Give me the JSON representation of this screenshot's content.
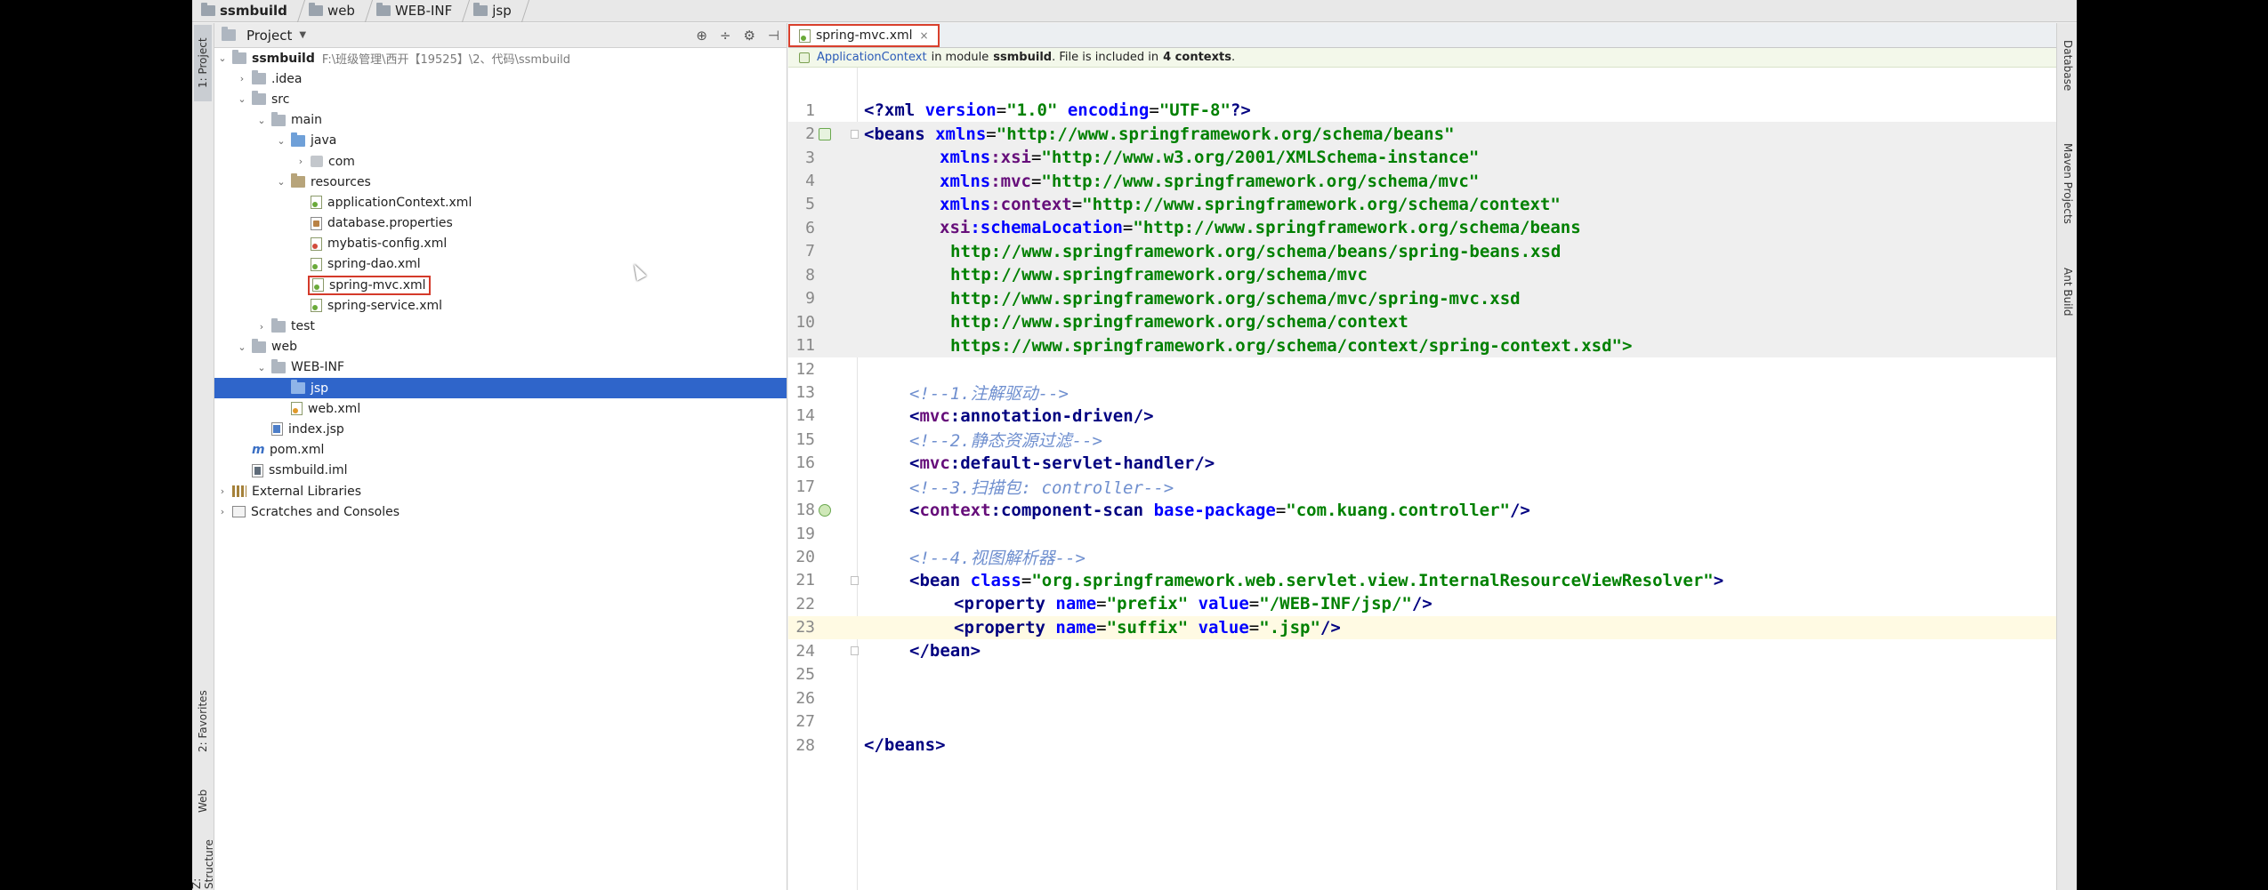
{
  "breadcrumb": [
    "ssmbuild",
    "web",
    "WEB-INF",
    "jsp"
  ],
  "left_strip": {
    "project_tab": "1: Project",
    "favorites_tab": "2: Favorites",
    "web_tab": "Web",
    "structure_tab": "Z: Structure"
  },
  "right_strip": {
    "database_tab": "Database",
    "maven_tab": "Maven Projects",
    "ant_tab": "Ant Build"
  },
  "project_panel": {
    "title": "Project",
    "root_name": "ssmbuild",
    "root_path": "F:\\班级管理\\西开【19525】\\2、代码\\ssmbuild",
    "items": {
      "idea": ".idea",
      "src": "src",
      "main": "main",
      "java": "java",
      "com": "com",
      "resources": "resources",
      "app_ctx": "applicationContext.xml",
      "db_props": "database.properties",
      "mybatis": "mybatis-config.xml",
      "spring_dao": "spring-dao.xml",
      "spring_mvc": "spring-mvc.xml",
      "spring_service": "spring-service.xml",
      "test": "test",
      "web": "web",
      "webinf": "WEB-INF",
      "jsp": "jsp",
      "webxml": "web.xml",
      "index": "index.jsp",
      "pom": "pom.xml",
      "iml": "ssmbuild.iml",
      "ext_libs": "External Libraries",
      "scratches": "Scratches and Consoles"
    }
  },
  "editor": {
    "tab_label": "spring-mvc.xml",
    "info": {
      "link": "ApplicationContext",
      "mid": "in module",
      "module": "ssmbuild",
      "tail": ". File is included in",
      "contexts": "4 contexts",
      "end": "."
    },
    "line_numbers": [
      "1",
      "2",
      "3",
      "4",
      "5",
      "6",
      "7",
      "8",
      "9",
      "10",
      "11",
      "12",
      "13",
      "14",
      "15",
      "16",
      "17",
      "18",
      "19",
      "20",
      "21",
      "22",
      "23",
      "24",
      "25",
      "26",
      "27",
      "28"
    ],
    "code": {
      "l1": [
        "<?",
        "xml ",
        "version",
        "=",
        "\"1.0\"",
        " ",
        "encoding",
        "=",
        "\"UTF-8\"",
        "?>"
      ],
      "l2": [
        "<",
        "beans ",
        "xmlns",
        "=",
        "\"http://www.springframework.org/schema/beans\""
      ],
      "l3": [
        "xmlns",
        ":xsi",
        "=",
        "\"http://www.w3.org/2001/XMLSchema-instance\""
      ],
      "l4": [
        "xmlns",
        ":mvc",
        "=",
        "\"http://www.springframework.org/schema/mvc\""
      ],
      "l5": [
        "xmlns",
        ":context",
        "=",
        "\"http://www.springframework.org/schema/context\""
      ],
      "l6": [
        "xsi",
        ":schemaLocation",
        "=",
        "\"http://www.springframework.org/schema/beans"
      ],
      "l7": "http://www.springframework.org/schema/beans/spring-beans.xsd",
      "l8": "http://www.springframework.org/schema/mvc",
      "l9": "http://www.springframework.org/schema/mvc/spring-mvc.xsd",
      "l10": "http://www.springframework.org/schema/context",
      "l11": "https://www.springframework.org/schema/context/spring-context.xsd\">",
      "l13": "<!--1.注解驱动-->",
      "l14": [
        "<",
        "mvc",
        ":annotation-driven",
        "/>"
      ],
      "l15": "<!--2.静态资源过滤-->",
      "l16": [
        "<",
        "mvc",
        ":default-servlet-handler",
        "/>"
      ],
      "l17": "<!--3.扫描包: controller-->",
      "l18": [
        "<",
        "context",
        ":component-scan ",
        "base-package",
        "=",
        "\"com.kuang.controller\"",
        "/>"
      ],
      "l20": "<!--4.视图解析器-->",
      "l21": [
        "<",
        "bean ",
        "class",
        "=",
        "\"org.springframework.web.servlet.view.InternalResourceViewResolver\"",
        ">"
      ],
      "l22": [
        "<",
        "property ",
        "name",
        "=",
        "\"prefix\"",
        " ",
        "value",
        "=",
        "\"/WEB-INF/jsp/\"",
        "/>"
      ],
      "l23": [
        "<",
        "property ",
        "name",
        "=",
        "\"suffix\"",
        " ",
        "value",
        "=",
        "\".jsp\"",
        "/>"
      ],
      "l24": [
        "</",
        "bean",
        ">"
      ],
      "l28": [
        "</",
        "beans",
        ">"
      ]
    }
  }
}
